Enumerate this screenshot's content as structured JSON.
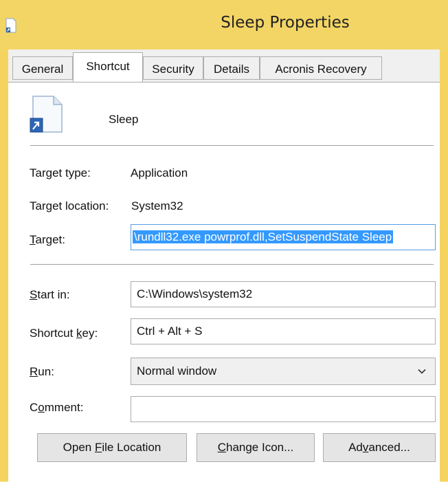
{
  "window": {
    "title": "Sleep Properties"
  },
  "tabs": [
    {
      "label": "General"
    },
    {
      "label": "Shortcut"
    },
    {
      "label": "Security"
    },
    {
      "label": "Details"
    },
    {
      "label": "Acronis Recovery"
    }
  ],
  "shortcut": {
    "name": "Sleep",
    "target_type_label": "Target type:",
    "target_type_value": "Application",
    "target_location_label": "Target location:",
    "target_location_value": "System32",
    "target_label_first": "T",
    "target_label_rest": "arget:",
    "target_value": "\\rundll32.exe powrprof.dll,SetSuspendState Sleep",
    "start_in_label_first": "S",
    "start_in_label_rest": "tart in:",
    "start_in_value": "C:\\Windows\\system32",
    "shortcut_key_label_pre": "Shortcut ",
    "shortcut_key_label_u": "k",
    "shortcut_key_label_post": "ey:",
    "shortcut_key_value": "Ctrl + Alt + S",
    "run_label_first": "R",
    "run_label_rest": "un:",
    "run_value": "Normal window",
    "comment_label_pre": "C",
    "comment_label_u": "o",
    "comment_label_post": "mment:",
    "comment_value": ""
  },
  "buttons": {
    "open_pre": "Open ",
    "open_u": "F",
    "open_post": "ile Location",
    "change_u": "C",
    "change_post": "hange Icon...",
    "adv_pre": "Ad",
    "adv_u": "v",
    "adv_post": "anced..."
  },
  "colors": {
    "frame": "#F4D45E",
    "selection": "#3399FF"
  }
}
